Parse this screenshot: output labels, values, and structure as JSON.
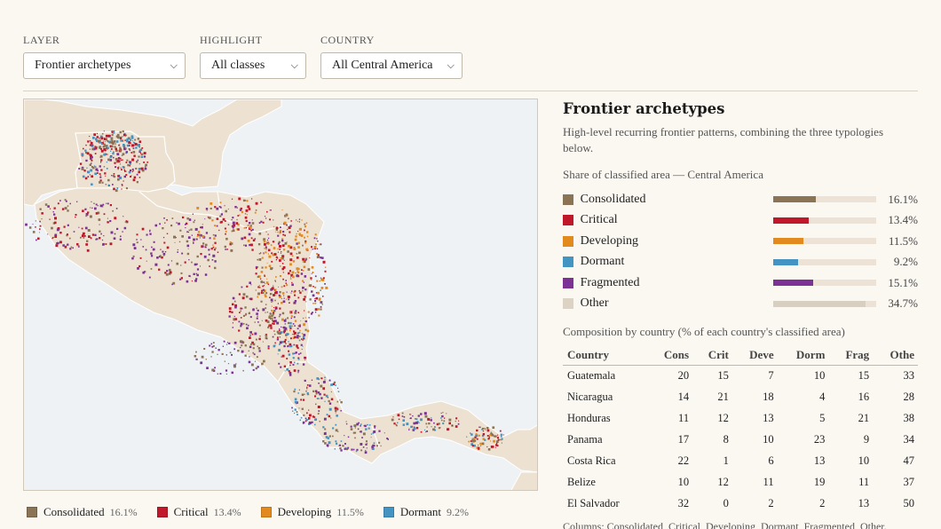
{
  "controls": [
    {
      "label": "LAYER",
      "value": "Frontier archetypes"
    },
    {
      "label": "HIGHLIGHT",
      "value": "All classes"
    },
    {
      "label": "COUNTRY",
      "value": "All Central America"
    }
  ],
  "panel": {
    "title": "Frontier archetypes",
    "description": "High-level recurring frontier patterns, combining the three typologies below.",
    "share_title": "Share of classified area — Central America",
    "shares": [
      {
        "name": "Consolidated",
        "pct": "16.1%",
        "value": 16.1,
        "color": "#8b7355"
      },
      {
        "name": "Critical",
        "pct": "13.4%",
        "value": 13.4,
        "color": "#c0182a"
      },
      {
        "name": "Developing",
        "pct": "11.5%",
        "value": 11.5,
        "color": "#e38a1e"
      },
      {
        "name": "Dormant",
        "pct": "9.2%",
        "value": 9.2,
        "color": "#4393c3"
      },
      {
        "name": "Fragmented",
        "pct": "15.1%",
        "value": 15.1,
        "color": "#7b3294"
      },
      {
        "name": "Other",
        "pct": "34.7%",
        "value": 34.7,
        "color": "#dcd3c5"
      }
    ],
    "composition_title": "Composition by country (% of each country's classified area)",
    "table": {
      "headers": [
        "Country",
        "Cons",
        "Crit",
        "Deve",
        "Dorm",
        "Frag",
        "Othe"
      ],
      "rows": [
        [
          "Guatemala",
          "20",
          "15",
          "7",
          "10",
          "15",
          "33"
        ],
        [
          "Nicaragua",
          "14",
          "21",
          "18",
          "4",
          "16",
          "28"
        ],
        [
          "Honduras",
          "11",
          "12",
          "13",
          "5",
          "21",
          "38"
        ],
        [
          "Panama",
          "17",
          "8",
          "10",
          "23",
          "9",
          "34"
        ],
        [
          "Costa Rica",
          "22",
          "1",
          "6",
          "13",
          "10",
          "47"
        ],
        [
          "Belize",
          "10",
          "12",
          "11",
          "19",
          "11",
          "37"
        ],
        [
          "El Salvador",
          "32",
          "0",
          "2",
          "2",
          "13",
          "50"
        ]
      ]
    },
    "columns_note": "Columns: Consolidated, Critical, Developing, Dormant, Fragmented, Other."
  },
  "legend": [
    {
      "name": "Consolidated",
      "pct": "16.1%",
      "color": "#8b7355"
    },
    {
      "name": "Critical",
      "pct": "13.4%",
      "color": "#c0182a"
    },
    {
      "name": "Developing",
      "pct": "11.5%",
      "color": "#e38a1e"
    },
    {
      "name": "Dormant",
      "pct": "9.2%",
      "color": "#4393c3"
    }
  ],
  "map": {
    "land_color": "#ede2d2",
    "sea_color": "#eef2f5",
    "border_color": "#ffffff"
  }
}
